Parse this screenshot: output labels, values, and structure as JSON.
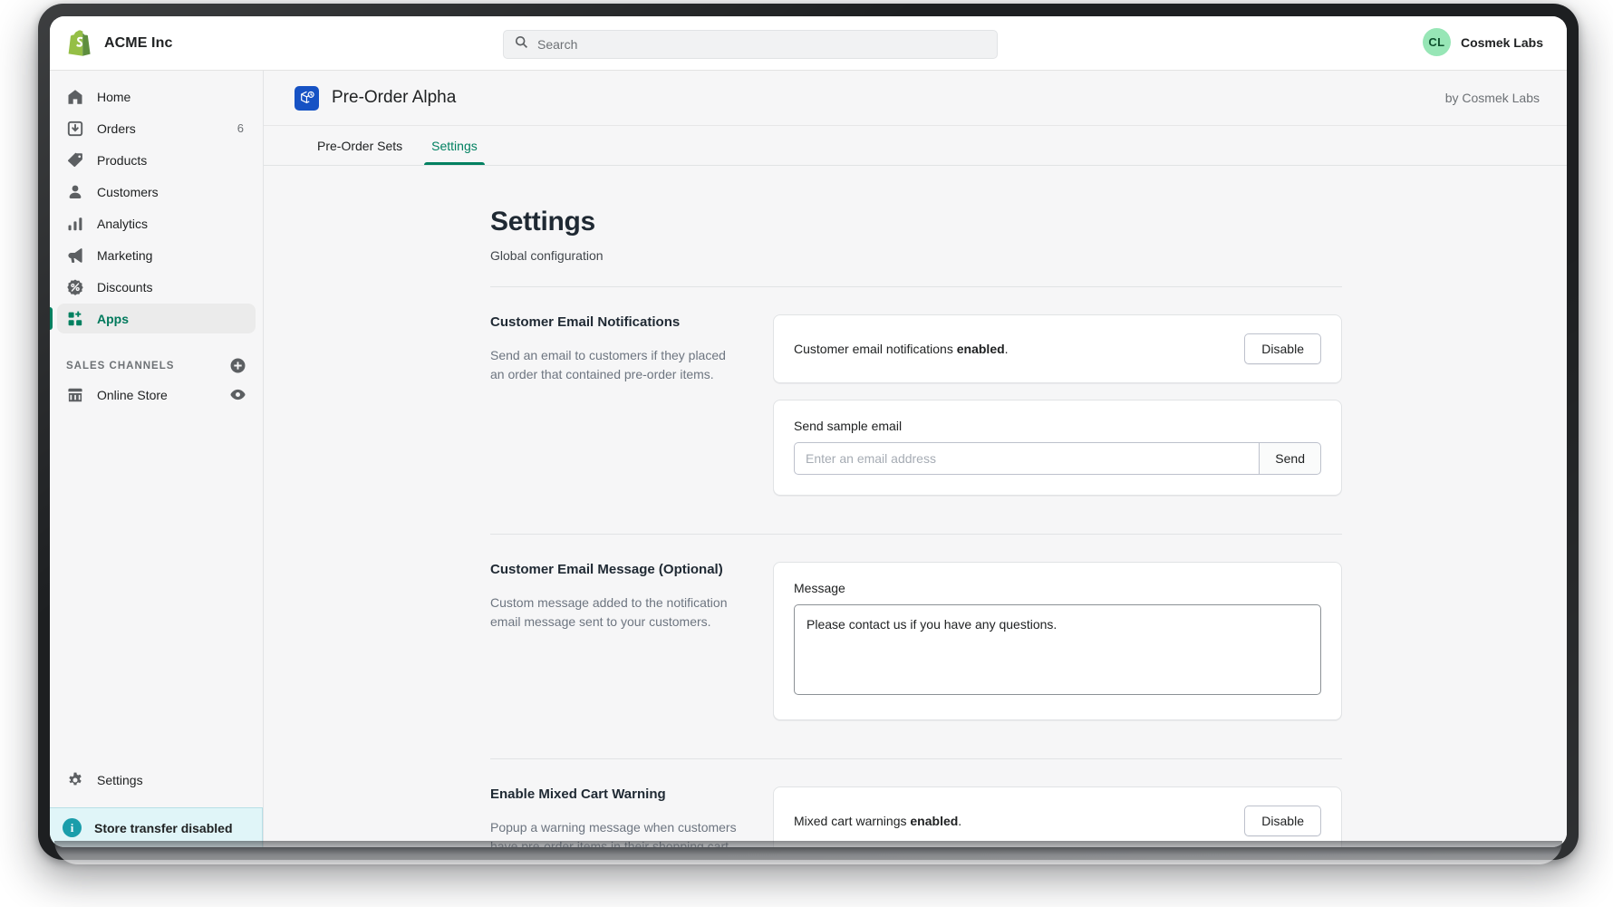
{
  "topbar": {
    "brand_name": "ACME Inc",
    "brand_icon": "shopify-bag-icon",
    "search_placeholder": "Search",
    "search_icon": "search-icon",
    "avatar_initials": "CL",
    "user_name": "Cosmek Labs",
    "avatar_color": "#97e6b6"
  },
  "sidebar": {
    "items": [
      {
        "label": "Home",
        "icon": "home-icon",
        "badge": "",
        "active": false
      },
      {
        "label": "Orders",
        "icon": "orders-inbox-icon",
        "badge": "6",
        "active": false
      },
      {
        "label": "Products",
        "icon": "product-tag-icon",
        "badge": "",
        "active": false
      },
      {
        "label": "Customers",
        "icon": "customer-person-icon",
        "badge": "",
        "active": false
      },
      {
        "label": "Analytics",
        "icon": "analytics-bars-icon",
        "badge": "",
        "active": false
      },
      {
        "label": "Marketing",
        "icon": "marketing-megaphone-icon",
        "badge": "",
        "active": false
      },
      {
        "label": "Discounts",
        "icon": "discount-percent-icon",
        "badge": "",
        "active": false
      },
      {
        "label": "Apps",
        "icon": "apps-grid-plus-icon",
        "badge": "",
        "active": true
      }
    ],
    "section": {
      "title": "SALES CHANNELS",
      "add_icon": "plus-circle-icon"
    },
    "channels": [
      {
        "label": "Online Store",
        "icon": "storefront-icon",
        "action_icon": "view-eye-icon"
      }
    ],
    "settings": {
      "label": "Settings",
      "icon": "gear-icon"
    },
    "transfer_banner": {
      "text": "Store transfer disabled",
      "icon": "info-circle-icon",
      "accent": "#1a9daa"
    },
    "active_accent": "#008060"
  },
  "app": {
    "icon": "preorder-box-clock-icon",
    "icon_bg": "#1652c4",
    "title": "Pre-Order Alpha",
    "author": "by Cosmek Labs",
    "tabs": [
      {
        "label": "Pre-Order Sets",
        "active": false
      },
      {
        "label": "Settings",
        "active": true
      }
    ],
    "tab_accent": "#008060"
  },
  "page": {
    "title": "Settings",
    "subtitle": "Global configuration",
    "sections": [
      {
        "heading": "Customer Email Notifications",
        "description": "Send an email to customers if they placed an order that contained pre-order items.",
        "status_prefix": "Customer email notifications ",
        "status_strong": "enabled",
        "status_suffix": ".",
        "toggle_button": "Disable",
        "sample_label": "Send sample email",
        "sample_placeholder": "Enter an email address",
        "sample_value": "",
        "sample_button": "Send"
      },
      {
        "heading": "Customer Email Message (Optional)",
        "description": "Custom message added to the notification email message sent to your customers.",
        "message_label": "Message",
        "message_value": "Please contact us if you have any questions."
      },
      {
        "heading": "Enable Mixed Cart Warning",
        "description": "Popup a warning message when customers have pre-order items in their shopping cart.",
        "status_prefix": "Mixed cart warnings ",
        "status_strong": "enabled",
        "status_suffix": ".",
        "toggle_button": "Disable"
      }
    ]
  }
}
